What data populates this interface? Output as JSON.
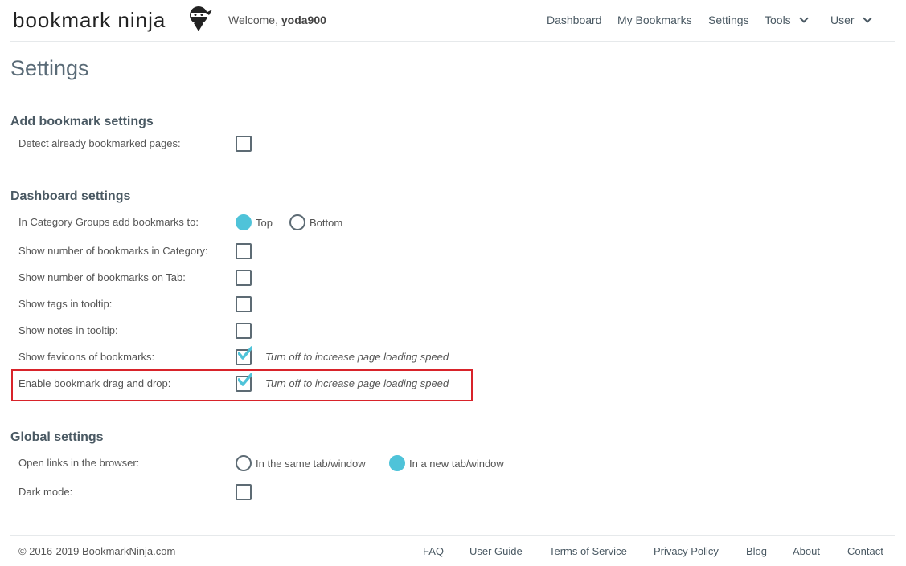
{
  "header": {
    "logo_text": "bookmark ninja",
    "welcome_prefix": "Welcome, ",
    "username": "yoda900",
    "nav": [
      {
        "label": "Dashboard"
      },
      {
        "label": "My Bookmarks"
      },
      {
        "label": "Settings"
      },
      {
        "label": "Tools"
      },
      {
        "label": "User"
      }
    ]
  },
  "page": {
    "title": "Settings"
  },
  "add_bookmark": {
    "heading": "Add bookmark settings",
    "detect_label": "Detect already bookmarked pages:",
    "detect_checked": false
  },
  "dashboard": {
    "heading": "Dashboard settings",
    "category_groups_label": "In Category Groups add bookmarks to:",
    "option_top": "Top",
    "option_bottom": "Bottom",
    "category_groups_selected": "Top",
    "rows": [
      {
        "label": "Show number of bookmarks in Category:",
        "checked": false
      },
      {
        "label": "Show number of bookmarks on Tab:",
        "checked": false
      },
      {
        "label": "Show tags in tooltip:",
        "checked": false
      },
      {
        "label": "Show notes in tooltip:",
        "checked": false
      },
      {
        "label": "Show favicons of bookmarks:",
        "checked": true,
        "hint": "Turn off to increase page loading speed"
      },
      {
        "label": "Enable bookmark drag and drop:",
        "checked": true,
        "hint": "Turn off to increase page loading speed"
      }
    ]
  },
  "global": {
    "heading": "Global settings",
    "open_links_label": "Open links in the browser:",
    "option_same": "In the same tab/window",
    "option_new": "In a new tab/window",
    "open_links_selected": "In a new tab/window",
    "dark_mode_label": "Dark mode:",
    "dark_mode_checked": false
  },
  "footer": {
    "copyright": "© 2016-2019 BookmarkNinja.com",
    "links": [
      "FAQ",
      "User Guide",
      "Terms of Service",
      "Privacy Policy",
      "Blog",
      "About",
      "Contact"
    ]
  },
  "colors": {
    "accent": "#4fc3d9",
    "highlight": "#d8232a",
    "text": "#4a5963"
  }
}
